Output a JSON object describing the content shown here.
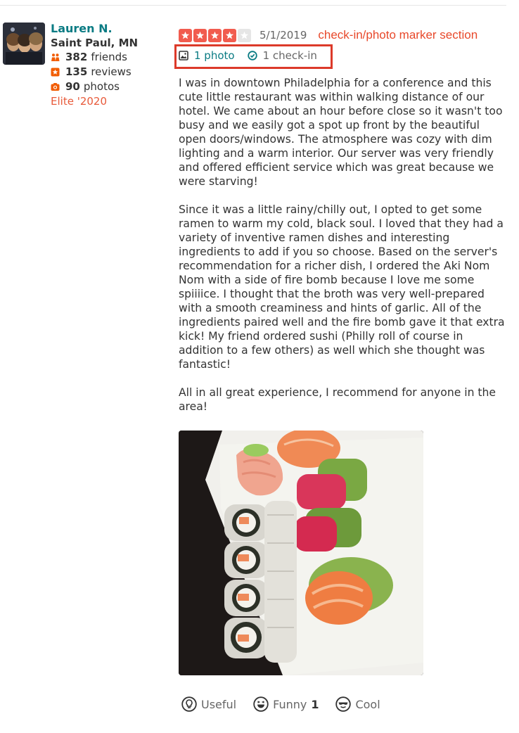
{
  "user": {
    "name": "Lauren N.",
    "location": "Saint Paul, MN",
    "friends_count": "382",
    "friends_label": "friends",
    "reviews_count": "135",
    "reviews_label": "reviews",
    "photos_count": "90",
    "photos_label": "photos",
    "elite": "Elite '2020"
  },
  "review": {
    "rating": 4,
    "max_rating": 5,
    "date": "5/1/2019",
    "annotation": "check-in/photo marker section",
    "photo_link": "1 photo",
    "checkin_link": "1 check-in",
    "paragraphs": [
      "I was in downtown Philadelphia for a conference and this cute little restaurant was within walking distance of our hotel. We came about an hour before close so it wasn't too busy and we easily got a spot up front by the beautiful open doors/windows. The atmosphere was cozy with dim lighting and a warm interior. Our server was very friendly and offered efficient service which was great because we were starving!",
      "Since it was a little rainy/chilly out, I opted to get some ramen to warm my cold, black soul. I loved that they had a variety of inventive ramen dishes and interesting ingredients to add if you so choose. Based on the server's recommendation for a richer dish, I ordered the Aki Nom Nom with a side of fire bomb because I love me some spiiiice. I thought that the broth was very well-prepared with a smooth creaminess and hints of garlic. All of the ingredients paired well and the fire bomb gave it that extra kick! My friend ordered sushi (Philly roll of course in addition to a few others) as well which she thought was fantastic!",
      "All in all great experience, I recommend for anyone in the area!"
    ]
  },
  "votes": {
    "useful_label": "Useful",
    "funny_label": "Funny",
    "funny_count": "1",
    "cool_label": "Cool"
  },
  "colors": {
    "brand_teal": "#0a7b83",
    "star_red": "#f15c4f",
    "elite_red": "#e85a3a",
    "marker_box": "#dc3a2a"
  }
}
